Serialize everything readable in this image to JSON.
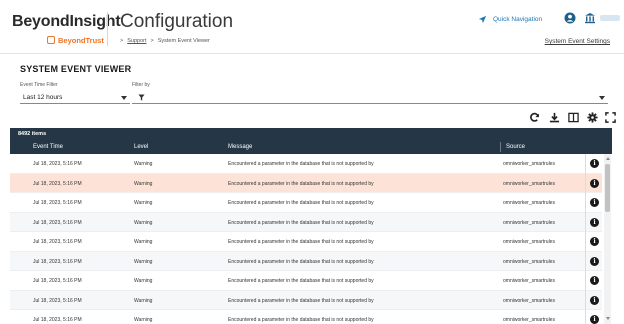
{
  "brand": {
    "name": "BeyondInsight",
    "sub": "BeyondTrust",
    "accent": "#f27321"
  },
  "header": {
    "title": "Configuration",
    "breadcrumb": {
      "link": "Support",
      "sep1": ">",
      "sep2": ">",
      "current": "System Event Viewer"
    },
    "quick_nav": "Quick Navigation",
    "settings_link": "System Event Settings"
  },
  "panel": {
    "title": "SYSTEM EVENT VIEWER",
    "time_filter_label": "Event Time Filter",
    "time_filter_value": "Last 12 hours",
    "filter_by_label": "Filter by"
  },
  "toolbar_icons": [
    "refresh-icon",
    "download-icon",
    "columns-icon",
    "settings-icon",
    "fullscreen-icon"
  ],
  "grid": {
    "count": "8492 items",
    "columns": {
      "time": "Event Time",
      "level": "Level",
      "message": "Message",
      "source": "Source"
    },
    "header_color": "#253746",
    "rows": [
      {
        "time": "Jul 18, 2023, 5:16 PM",
        "level": "Warning",
        "message": "Encountered a parameter in the database that is not supported by",
        "source": "omniworker_smartrules"
      },
      {
        "time": "Jul 18, 2023, 5:16 PM",
        "level": "Warning",
        "message": "Encountered a parameter in the database that is not supported by",
        "source": "omniworker_smartrules"
      },
      {
        "time": "Jul 18, 2023, 5:16 PM",
        "level": "Warning",
        "message": "Encountered a parameter in the database that is not supported by",
        "source": "omniworker_smartrules"
      },
      {
        "time": "Jul 18, 2023, 5:16 PM",
        "level": "Warning",
        "message": "Encountered a parameter in the database that is not supported by",
        "source": "omniworker_smartrules"
      },
      {
        "time": "Jul 18, 2023, 5:16 PM",
        "level": "Warning",
        "message": "Encountered a parameter in the database that is not supported by",
        "source": "omniworker_smartrules"
      },
      {
        "time": "Jul 18, 2023, 5:16 PM",
        "level": "Warning",
        "message": "Encountered a parameter in the database that is not supported by",
        "source": "omniworker_smartrules"
      },
      {
        "time": "Jul 18, 2023, 5:16 PM",
        "level": "Warning",
        "message": "Encountered a parameter in the database that is not supported by",
        "source": "omniworker_smartrules"
      },
      {
        "time": "Jul 18, 2023, 5:16 PM",
        "level": "Warning",
        "message": "Encountered a parameter in the database that is not supported by",
        "source": "omniworker_smartrules"
      },
      {
        "time": "Jul 18, 2023, 5:16 PM",
        "level": "Warning",
        "message": "Encountered a parameter in the database that is not supported by",
        "source": "omniworker_smartrules"
      }
    ],
    "selected_row": 1
  }
}
